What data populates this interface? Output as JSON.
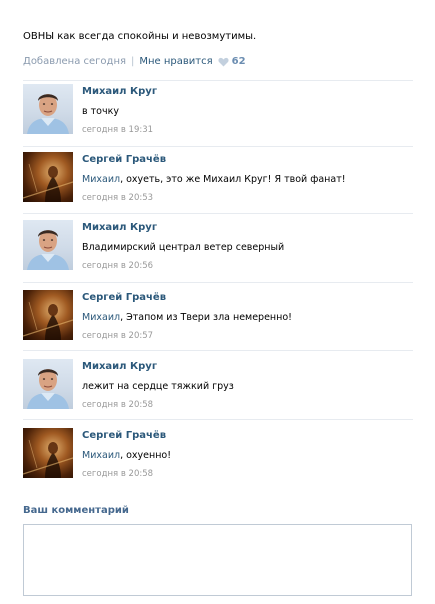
{
  "post": {
    "text": "ОВНЫ как всегда спокойны и невозмутимы.",
    "added": "Добавлена сегодня",
    "like_label": "Мне нравится",
    "like_count": "62"
  },
  "comments": [
    {
      "author": "Михаил Круг",
      "mention": "",
      "text": "в точку",
      "date": "сегодня в 19:31",
      "avatar": "krug"
    },
    {
      "author": "Сергей Грачёв",
      "mention": "Михаил",
      "text": ", охуеть, это же Михаил Круг! Я твой фанат!",
      "date": "сегодня в 20:53",
      "avatar": "grachev"
    },
    {
      "author": "Михаил Круг",
      "mention": "",
      "text": "Владимирский централ ветер северный",
      "date": "сегодня в 20:56",
      "avatar": "krug"
    },
    {
      "author": "Сергей Грачёв",
      "mention": "Михаил",
      "text": ", Этапом из Твери зла немеренно!",
      "date": "сегодня в 20:57",
      "avatar": "grachev"
    },
    {
      "author": "Михаил Круг",
      "mention": "",
      "text": "лежит на сердце тяжкий груз",
      "date": "сегодня в 20:58",
      "avatar": "krug"
    },
    {
      "author": "Сергей Грачёв",
      "mention": "Михаил",
      "text": ", охуенно!",
      "date": "сегодня в 20:58",
      "avatar": "grachev"
    }
  ],
  "comment_form": {
    "label": "Ваш комментарий",
    "placeholder": ""
  },
  "colors": {
    "link": "#2b587a",
    "muted": "#999999",
    "heart": "#c3d0de"
  }
}
